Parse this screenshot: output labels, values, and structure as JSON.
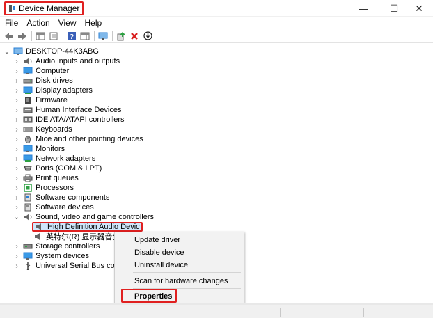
{
  "window": {
    "title": "Device Manager",
    "controls": {
      "minimize": "—",
      "maximize": "☐",
      "close": "✕"
    }
  },
  "menu": [
    {
      "label": "File"
    },
    {
      "label": "Action"
    },
    {
      "label": "View"
    },
    {
      "label": "Help"
    }
  ],
  "toolbar": {
    "buttons": [
      "back-icon",
      "forward-icon",
      "show-hide-console-tree-icon",
      "properties-icon",
      "help-icon",
      "action-pane-icon",
      "scan-hardware-icon",
      "update-driver-icon",
      "uninstall-device-icon",
      "disable-device-icon"
    ]
  },
  "tree": {
    "root": "DESKTOP-44K3ABG",
    "categories": [
      {
        "label": "Audio inputs and outputs",
        "icon": "speaker-icon"
      },
      {
        "label": "Computer",
        "icon": "computer-icon"
      },
      {
        "label": "Disk drives",
        "icon": "disk-icon"
      },
      {
        "label": "Display adapters",
        "icon": "display-adapter-icon"
      },
      {
        "label": "Firmware",
        "icon": "firmware-icon"
      },
      {
        "label": "Human Interface Devices",
        "icon": "hid-icon"
      },
      {
        "label": "IDE ATA/ATAPI controllers",
        "icon": "ide-icon"
      },
      {
        "label": "Keyboards",
        "icon": "keyboard-icon"
      },
      {
        "label": "Mice and other pointing devices",
        "icon": "mouse-icon"
      },
      {
        "label": "Monitors",
        "icon": "monitor-icon"
      },
      {
        "label": "Network adapters",
        "icon": "network-icon"
      },
      {
        "label": "Ports (COM & LPT)",
        "icon": "port-icon"
      },
      {
        "label": "Print queues",
        "icon": "printer-icon"
      },
      {
        "label": "Processors",
        "icon": "processor-icon"
      },
      {
        "label": "Software components",
        "icon": "software-component-icon"
      },
      {
        "label": "Software devices",
        "icon": "software-device-icon"
      },
      {
        "label": "Sound, video and game controllers",
        "icon": "sound-icon",
        "expanded": true
      }
    ],
    "sound_children": [
      {
        "label": "High Definition Audio Devic",
        "selected": true
      },
      {
        "label": "英特尔(R) 显示器音频"
      }
    ],
    "after": [
      {
        "label": "Storage controllers",
        "icon": "storage-icon"
      },
      {
        "label": "System devices",
        "icon": "system-icon"
      },
      {
        "label": "Universal Serial Bus control",
        "icon": "usb-icon"
      }
    ]
  },
  "context_menu": {
    "items": [
      {
        "label": "Update driver"
      },
      {
        "label": "Disable device"
      },
      {
        "label": "Uninstall device"
      },
      {
        "label": "Scan for hardware changes"
      },
      {
        "label": "Properties",
        "bold": true,
        "highlighted": true
      }
    ]
  },
  "colors": {
    "annotation": "#e02020",
    "selection": "#cfe6fb",
    "icon_blue": "#2a7fd4"
  }
}
